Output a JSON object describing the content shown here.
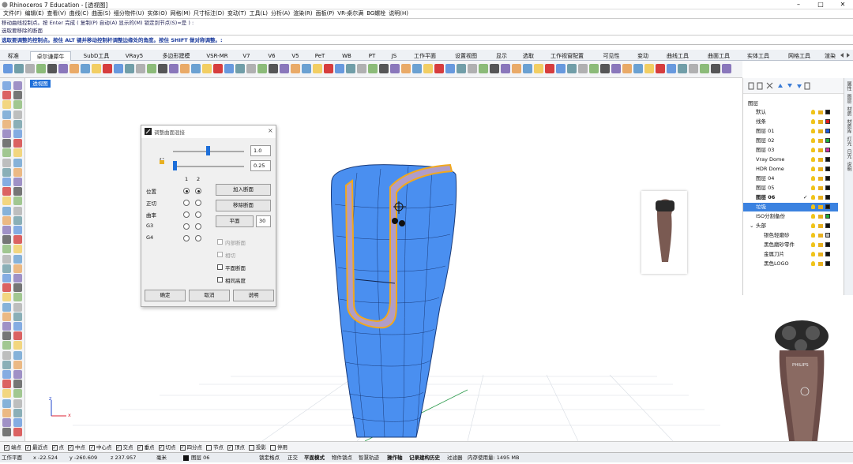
{
  "window": {
    "title": "Rhinoceros 7 Education - [透视图]",
    "minimize": "–",
    "maximize": "□",
    "close": "✕"
  },
  "menu": [
    "文件(F)",
    "编辑(E)",
    "查看(V)",
    "曲线(C)",
    "曲面(S)",
    "细分物件(U)",
    "实体(O)",
    "网格(M)",
    "尺寸标注(D)",
    "变动(T)",
    "工具(L)",
    "分析(A)",
    "渲染(R)",
    "面板(P)",
    "VR-桌尔满",
    "BG螺栓",
    "说明(H)"
  ],
  "command_history": [
    "移动曲线控制点。按 Enter 完成 ( 复制(P) 自动(A) 显示的(M) 锁定到节点(S)=是 ) :",
    "选取要移除的断面"
  ],
  "command_prompt": "选取要调整的控制点。按住 ALT 键并移动控制杆调整边缘处的角度。按住 SHIFT 做对称调整。:",
  "tabs": [
    "标准",
    "卓尔谦犀牛",
    "SubD工具",
    "VRay5",
    "多边形建模",
    "VSR-MR",
    "V7",
    "V6",
    "V5",
    "PeT",
    "WB",
    "PT",
    "JS",
    "工作平面",
    "设置视图",
    "显示",
    "选取",
    "工作视窗配置",
    "可见性",
    "变动",
    "曲线工具",
    "曲面工具",
    "实体工具",
    "网格工具",
    "渲染"
  ],
  "active_tab_index": 1,
  "viewport": {
    "label": "透视图",
    "axis_x": "x",
    "axis_z": "z"
  },
  "dialog": {
    "title": "调整曲面混接",
    "value1": "1.0",
    "value2": "0.25",
    "col1": "1",
    "col2": "2",
    "rows": [
      "位置",
      "正切",
      "曲率",
      "G3",
      "G4"
    ],
    "add_section": "加入断面",
    "remove_section": "移除断面",
    "planar": "平面",
    "planar_value": "30",
    "checks": [
      "内部断面",
      "相切",
      "平面断面",
      "相同高度"
    ],
    "ok": "确定",
    "cancel": "取消",
    "help": "说明"
  },
  "layers": {
    "header": "图层",
    "items": [
      {
        "name": "默认",
        "color": "#111111",
        "indent": 0
      },
      {
        "name": "线条",
        "color": "#e11b1b",
        "indent": 0
      },
      {
        "name": "图层 01",
        "color": "#1e5be0",
        "indent": 0
      },
      {
        "name": "图层 02",
        "color": "#21b03a",
        "indent": 0
      },
      {
        "name": "图层 03",
        "color": "#d62ea0",
        "indent": 0
      },
      {
        "name": "Vray Dome",
        "color": "#111111",
        "indent": 0
      },
      {
        "name": "HDR Dome",
        "color": "#111111",
        "indent": 0
      },
      {
        "name": "图层 04",
        "color": "#111111",
        "indent": 0
      },
      {
        "name": "图层 05",
        "color": "#111111",
        "indent": 0
      },
      {
        "name": "图层 06",
        "color": "#111111",
        "indent": 0,
        "current": true
      },
      {
        "name": "垃圾",
        "color": "#111111",
        "indent": 0,
        "selected": true
      },
      {
        "name": "ISO分割备份",
        "color": "#21b03a",
        "indent": 0
      },
      {
        "name": "头部",
        "color": "#111111",
        "indent": 0,
        "expanded": true
      },
      {
        "name": "银色轻磨砂",
        "color": "#bbbbbb",
        "indent": 1
      },
      {
        "name": "黑色磨砂零件",
        "color": "#111111",
        "indent": 1
      },
      {
        "name": "金属刀片",
        "color": "#111111",
        "indent": 1
      },
      {
        "name": "黑色LOGO",
        "color": "#111111",
        "indent": 1
      }
    ]
  },
  "side_tabs": [
    "属性",
    "图层",
    "材质",
    "材质库",
    "灯光",
    "日光",
    "说明"
  ],
  "osnap": [
    "端点",
    "最近点",
    "点",
    "中点",
    "中心点",
    "交点",
    "垂点",
    "切点",
    "四分点",
    "节点",
    "顶点",
    "投影",
    "停用"
  ],
  "osnap_checked": [
    true,
    true,
    true,
    true,
    true,
    true,
    true,
    true,
    true,
    false,
    true,
    false,
    false
  ],
  "status": {
    "cplane": "工作平面",
    "x": "x -22.524",
    "y": "y -260.609",
    "z": "z 237.957",
    "unit": "毫米",
    "layer": "图层 06",
    "items": [
      "锁定格点",
      "正交",
      "平面模式",
      "物件锁点",
      "智慧轨迹",
      "操作轴",
      "记录建构历史",
      "过滤器"
    ],
    "memory": "内存使用量: 1495 MB"
  },
  "photo_brand": "PHILIPS",
  "colors": {
    "accent": "#1e6fd9",
    "model_blue": "#4a8ff0",
    "highlight": "#f2a81d"
  }
}
